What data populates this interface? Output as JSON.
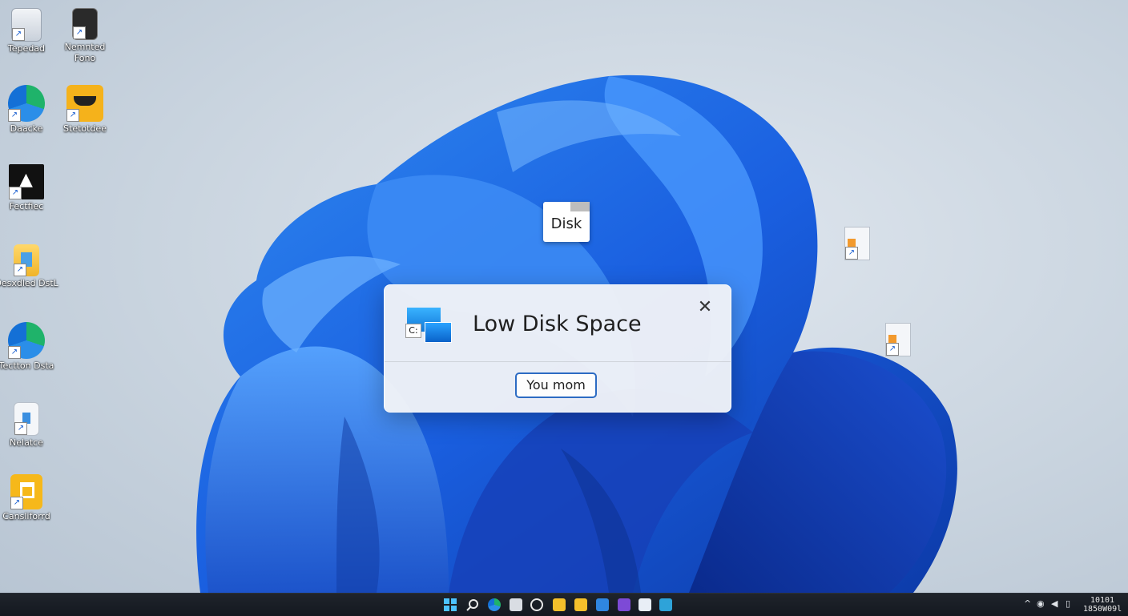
{
  "desktop": {
    "icons": [
      {
        "label": "Tepedad"
      },
      {
        "label": "Nemnted Fono"
      },
      {
        "label": "Daacke"
      },
      {
        "label": "Stetotdee"
      },
      {
        "label": "Fectfiec"
      },
      {
        "label": "Oesxdled DstL"
      },
      {
        "label": "Tectton Dsta"
      },
      {
        "label": "Nelatce"
      },
      {
        "label": "Cansliforrd"
      }
    ]
  },
  "floating_tag": {
    "label": "Disk"
  },
  "dialog": {
    "title": "Low Disk Space",
    "close_glyph": "✕",
    "drive_letter": "C:",
    "button_label": "You mom"
  },
  "taskbar": {
    "apps": [
      "start",
      "search",
      "edge",
      "file-explorer",
      "cortana",
      "folder",
      "folder",
      "store",
      "teams",
      "photos",
      "chart"
    ],
    "clock": {
      "time": "10101",
      "date": "1850W09l"
    }
  },
  "colors": {
    "accent": "#2c6bc3",
    "taskbar": "#1a1e25"
  }
}
